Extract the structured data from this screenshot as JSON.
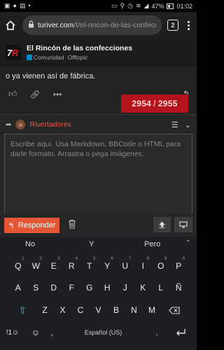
{
  "status_bar": {
    "battery": "47%",
    "time": "01:02"
  },
  "browser": {
    "url_host": "turiver.com",
    "url_path": "/t/el-rincon-de-las-confecc",
    "tabs_count": "2"
  },
  "forum": {
    "title": "El Rincón de las confecciones",
    "category": "Comunidad",
    "subcategory": "Offtopic"
  },
  "post": {
    "text_line2": "o ya vienen así de fábrica.",
    "progress_current": "2954",
    "progress_total": "2955"
  },
  "composer": {
    "username": "Rivertadores",
    "placeholder": "Escribe aquí. Usa Markdown, BBCode o HTML para darle formato. Arrastra o pega imágenes.",
    "reply_button": "Responder"
  },
  "keyboard": {
    "suggestions": [
      "No",
      "Y",
      "Pero"
    ],
    "row1": [
      "Q",
      "W",
      "E",
      "R",
      "T",
      "Y",
      "U",
      "I",
      "O",
      "P"
    ],
    "row1_hints": [
      "1",
      "2",
      "3",
      "4",
      "5",
      "6",
      "7",
      "8",
      "9",
      "0"
    ],
    "row2": [
      "A",
      "S",
      "D",
      "F",
      "G",
      "H",
      "J",
      "K",
      "L",
      "Ñ"
    ],
    "row3": [
      "Z",
      "X",
      "C",
      "V",
      "B",
      "N",
      "M"
    ],
    "symbols_key": "!1☺",
    "language": "Español (US)",
    "colors": {
      "accent": "#e45735",
      "badge": "#b3141b",
      "shift": "#5ab4e5"
    }
  }
}
